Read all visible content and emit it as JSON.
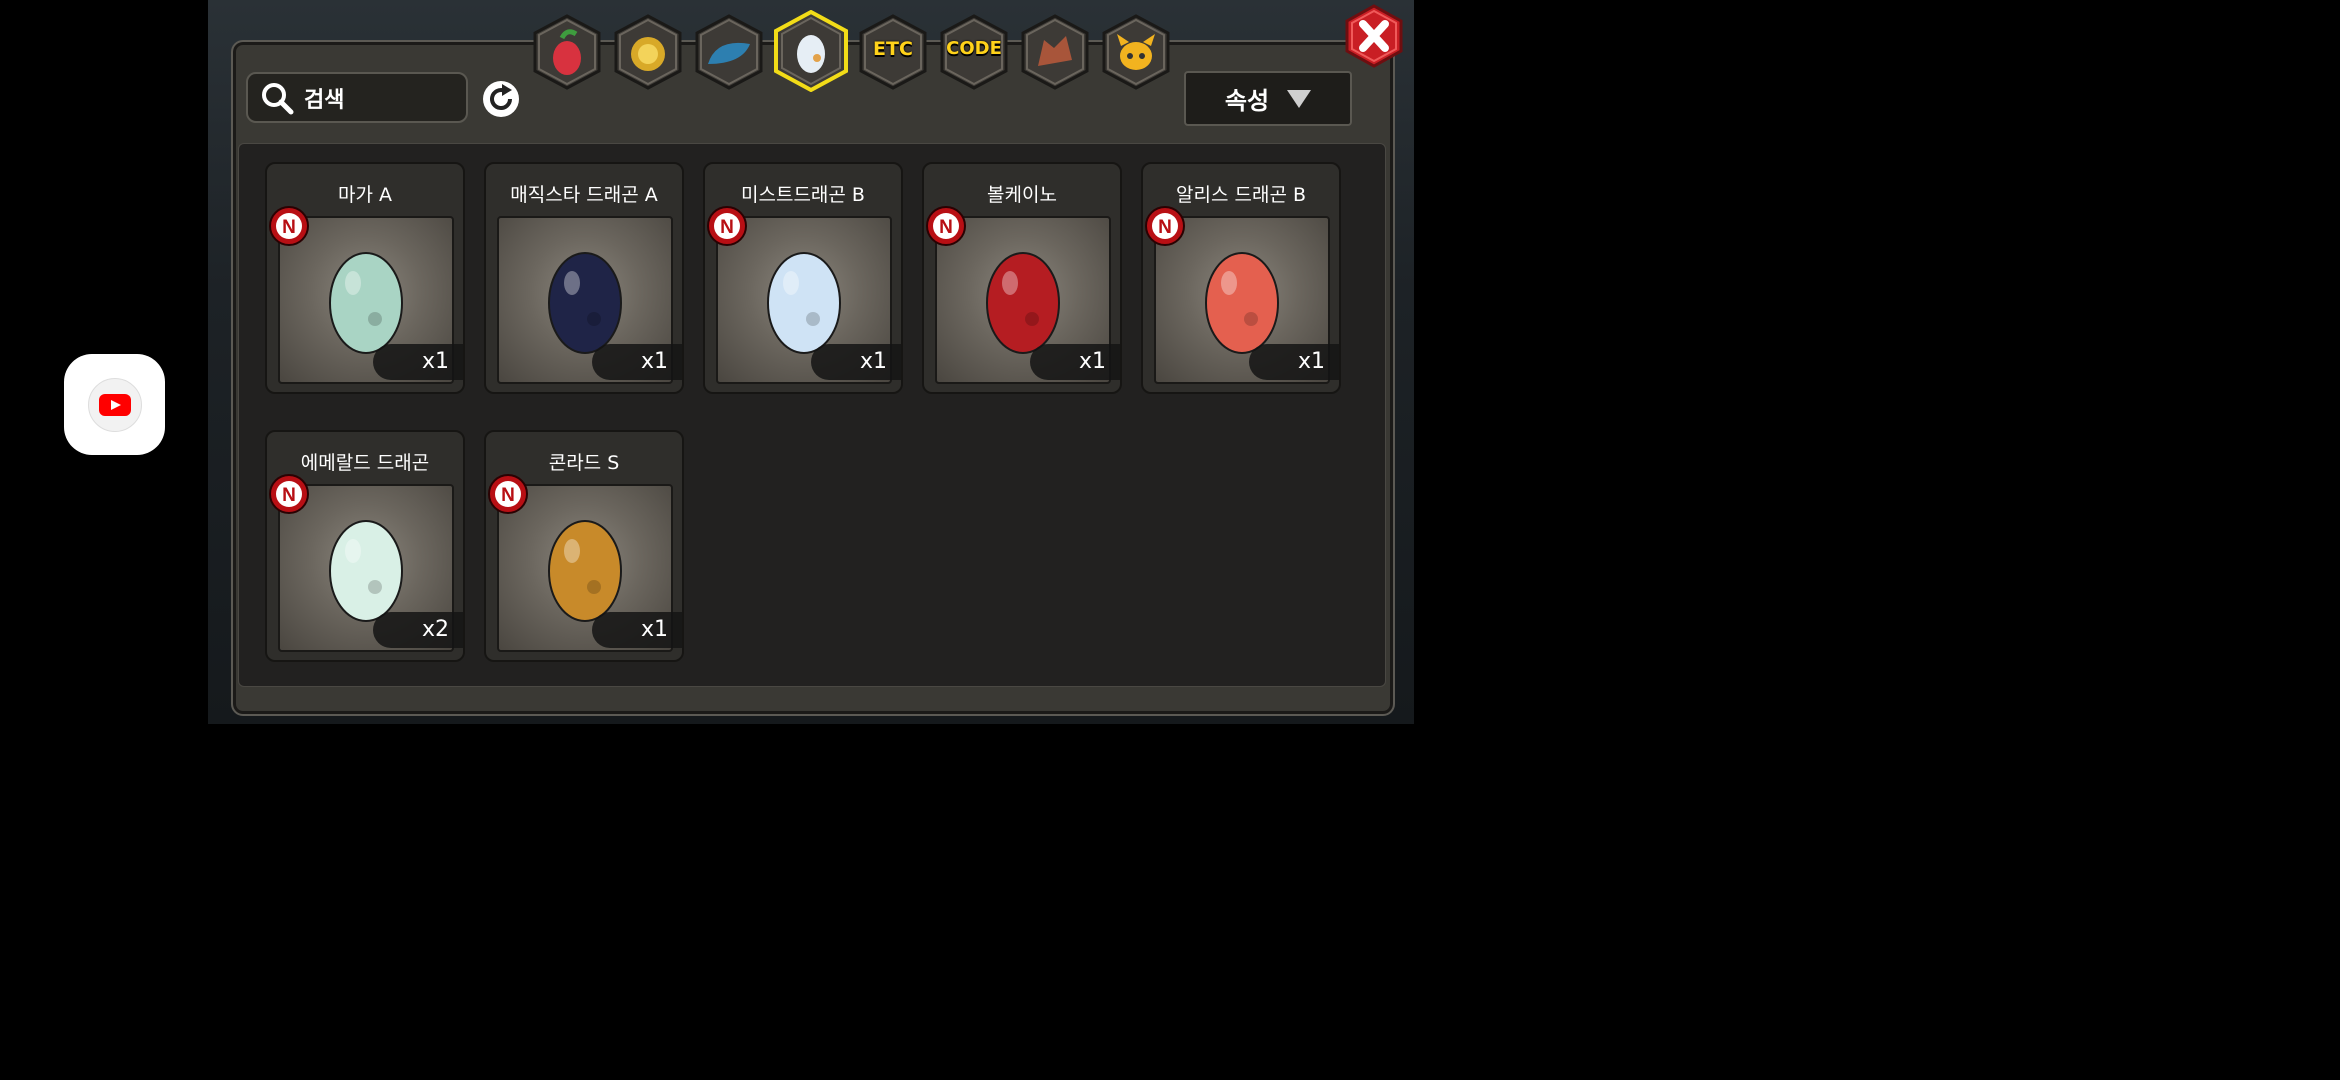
{
  "search": {
    "placeholder": "검색"
  },
  "sort": {
    "label": "속성"
  },
  "tabs": [
    {
      "name": "fruit",
      "label": ""
    },
    {
      "name": "gold",
      "label": ""
    },
    {
      "name": "dragon-scale",
      "label": ""
    },
    {
      "name": "egg",
      "label": "",
      "selected": true
    },
    {
      "name": "etc",
      "label": "ETC"
    },
    {
      "name": "code",
      "label": "CODE"
    },
    {
      "name": "dragon",
      "label": ""
    },
    {
      "name": "mask",
      "label": ""
    }
  ],
  "items": [
    {
      "name": "마가 A",
      "qty": "x1",
      "new_badge": "N",
      "egg_color": "#a9d4c4"
    },
    {
      "name": "매직스타 드래곤 A",
      "qty": "x1",
      "new_badge": "",
      "egg_color": "#1f2447"
    },
    {
      "name": "미스트드래곤 B",
      "qty": "x1",
      "new_badge": "N",
      "egg_color": "#cfe3f5"
    },
    {
      "name": "볼케이노",
      "qty": "x1",
      "new_badge": "N",
      "egg_color": "#b51d22"
    },
    {
      "name": "알리스 드래곤 B",
      "qty": "x1",
      "new_badge": "N",
      "egg_color": "#e4604f"
    },
    {
      "name": "에메랄드 드래곤",
      "qty": "x2",
      "new_badge": "N",
      "egg_color": "#d9f0e6"
    },
    {
      "name": "콘라드 S",
      "qty": "x1",
      "new_badge": "N",
      "egg_color": "#c88a2a"
    }
  ]
}
